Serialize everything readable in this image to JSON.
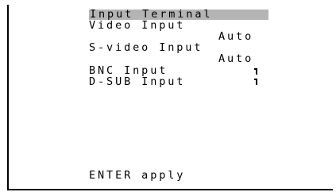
{
  "menu": {
    "title": "Input Terminal",
    "items": [
      {
        "label": "Video Input",
        "value": "Auto"
      },
      {
        "label": "S-video Input",
        "value": "Auto"
      },
      {
        "label": "BNC Input",
        "value": "",
        "marker": "corner-marker-icon"
      },
      {
        "label": "D-SUB Input",
        "value": "",
        "marker": "corner-marker-icon"
      }
    ],
    "footer": "ENTER apply"
  },
  "colors": {
    "background": "#ffffff",
    "text": "#000000",
    "highlight": "#b4b4b4"
  }
}
